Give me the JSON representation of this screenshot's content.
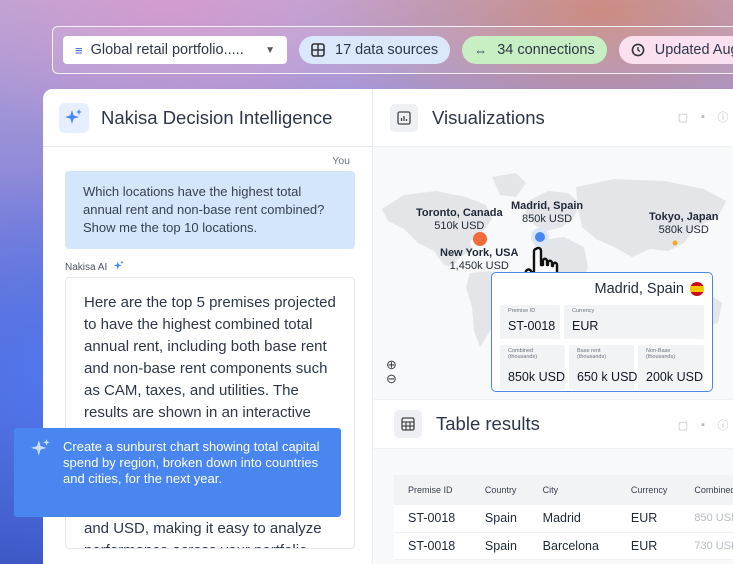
{
  "topbar": {
    "portfolio_select": "Global retail portfolio.....",
    "data_sources": "17 data sources",
    "connections": "34 connections",
    "updated": "Updated Aug"
  },
  "chat": {
    "title": "Nakisa Decision Intelligence",
    "you_label": "You",
    "user_message": "Which locations have the highest total annual rent and non-base rent combined? Show me the top 10 locations.",
    "ai_label": "Nakisa AI",
    "ai_message": "Here are the top 5 premises projected to have the highest combined total annual rent, including both base rent and non-base rent components such as CAM, taxes, and utilities. The results are shown in an interactive map for quick geographic context and in a detailed",
    "ai_message_tail": "and USD, making it easy to analyze performance across your portfolio."
  },
  "prompt": {
    "text": "Create a sunburst chart showing total capital spend by region, broken down into countries and cities, for the next year."
  },
  "visualizations": {
    "title": "Visualizations",
    "cities": [
      {
        "name": "Toronto, Canada",
        "value": "510k USD"
      },
      {
        "name": "Madrid, Spain",
        "value": "850k USD"
      },
      {
        "name": "Tokyo, Japan",
        "value": "580k USD"
      },
      {
        "name": "New York, USA",
        "value": "1,450k USD"
      }
    ],
    "zoom_in": "⊕",
    "zoom_out": "⊖",
    "detail": {
      "title": "Madrid, Spain",
      "premise_id_caption": "Premise ID",
      "premise_id": "ST-0018",
      "currency_caption": "Currency",
      "currency": "EUR",
      "combined_caption_1": "Combined",
      "combined_caption_2": "(thousands)",
      "combined": "850k USD",
      "base_caption_1": "Base rent",
      "base_caption_2": "(thousands)",
      "base": "650 k USD",
      "nonbase_caption_1": "Non-Base",
      "nonbase_caption_2": "(thousands)",
      "nonbase": "200k USD"
    }
  },
  "table": {
    "title": "Table results",
    "columns": [
      "Premise ID",
      "Country",
      "City",
      "Currency",
      "Combined"
    ],
    "rows": [
      [
        "ST-0018",
        "Spain",
        "Madrid",
        "EUR",
        "850 USD"
      ],
      [
        "ST-0018",
        "Spain",
        "Barcelona",
        "EUR",
        "730 USD"
      ]
    ]
  },
  "colors": {
    "accent_blue": "#4a86f0",
    "user_bubble": "#d4e6fc",
    "marker_orange": "#f26b3a",
    "chip_blue": "#dbe8fb",
    "chip_green": "#c8efc4",
    "chip_pink": "#fbe1f0"
  }
}
